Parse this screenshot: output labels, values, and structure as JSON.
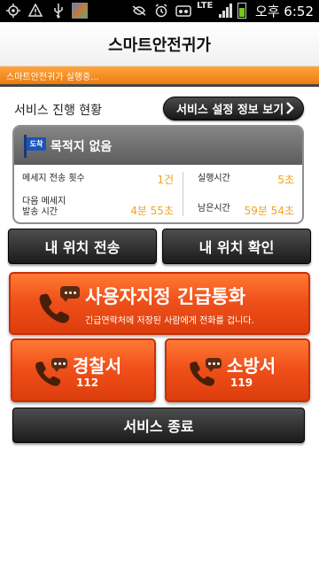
{
  "status_bar": {
    "icons": [
      "gps-target-icon",
      "warning-icon",
      "usb-icon",
      "image-thumbnail",
      "muted-icon",
      "alarm-icon",
      "voicemail-icon",
      "lte-icon",
      "signal-icon",
      "battery-icon"
    ],
    "network": "LTE",
    "time": "오후 6:52"
  },
  "app_title": "스마트안전귀가",
  "status_strip": "스마트안전귀가 실행중...",
  "progress": {
    "label": "서비스 진행 현황",
    "settings_button": "서비스 설정 정보 보기",
    "badge": "도착",
    "destination": "목적지 없음",
    "send_count_label": "메세지 전송 횟수",
    "send_count_value": "1건",
    "run_time_label": "실행시간",
    "run_time_value": "5초",
    "next_message_label_1": "다음 메세지",
    "next_message_label_2": "발송 시간",
    "next_message_value": "4분 55초",
    "remaining_label": "남은시간",
    "remaining_value": "59분 54초"
  },
  "location": {
    "send_button": "내 위치 전송",
    "check_button": "내 위치 확인"
  },
  "emergency": {
    "title": "사용자지정 긴급통화",
    "desc": "긴급연락처에 저장된 사람에게 전화를 겁니다.",
    "police": "경찰서",
    "police_number": "112",
    "fire": "소방서",
    "fire_number": "119"
  },
  "end_button": "서비스 종료",
  "colors": {
    "accent_orange": "#f0511b",
    "strip_orange": "#ed7b10",
    "value_orange": "#f3a21d",
    "dark_button": "#1b1b1b"
  }
}
